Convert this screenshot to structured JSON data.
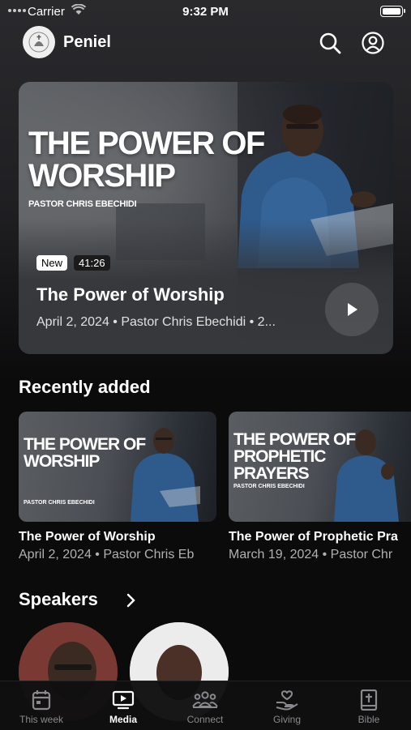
{
  "status_bar": {
    "carrier": "Carrier",
    "time": "9:32 PM"
  },
  "header": {
    "app_name": "Peniel",
    "icons": [
      "logo-icon",
      "search-icon",
      "profile-icon"
    ]
  },
  "hero": {
    "artwork_title": "THE POWER OF WORSHIP",
    "artwork_subtitle": "PASTOR CHRIS EBECHIDI",
    "badge": "New",
    "duration": "41:26",
    "title": "The Power of Worship",
    "meta": "April 2, 2024 • Pastor Chris Ebechidi • 2..."
  },
  "recently_added": {
    "heading": "Recently added",
    "items": [
      {
        "artwork_title": "THE POWER OF WORSHIP",
        "artwork_subtitle": "PASTOR CHRIS EBECHIDI",
        "title": "The Power of Worship",
        "meta": "April 2, 2024 • Pastor Chris Eb"
      },
      {
        "artwork_title": "THE POWER OF PROPHETIC PRAYERS",
        "artwork_subtitle": "PASTOR CHRIS EBECHIDI",
        "title": "The Power of Prophetic Pra",
        "meta": "March 19, 2024 • Pastor Chr"
      }
    ]
  },
  "speakers": {
    "heading": "Speakers"
  },
  "tab_bar": {
    "items": [
      {
        "label": "This week",
        "icon": "calendar-icon",
        "active": false
      },
      {
        "label": "Media",
        "icon": "media-icon",
        "active": true
      },
      {
        "label": "Connect",
        "icon": "people-icon",
        "active": false
      },
      {
        "label": "Giving",
        "icon": "giving-icon",
        "active": false
      },
      {
        "label": "Bible",
        "icon": "bible-icon",
        "active": false
      }
    ]
  },
  "colors": {
    "background": "#0b0b0c",
    "card": "#36383c",
    "tab_inactive": "#8a8a8e",
    "tab_active": "#ffffff"
  }
}
